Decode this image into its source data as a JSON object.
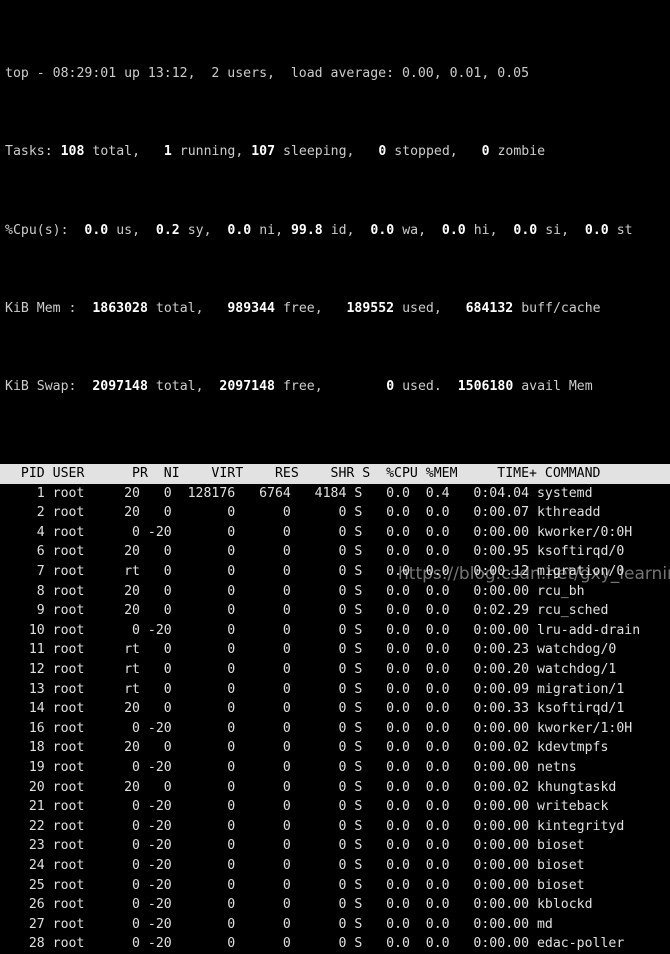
{
  "terminal": {
    "background_color": "#000000",
    "foreground_color": "#d8d8d8",
    "header_bar_bg": "#e2e2e2",
    "header_bar_fg": "#000000"
  },
  "summary": {
    "uptime_line": {
      "program": "top",
      "separator": "-",
      "time": "08:29:01",
      "up_label": "up",
      "uptime": "13:12,",
      "users_count": "2",
      "users_label": "users,",
      "load_label": "load average:",
      "load_1min": "0.00,",
      "load_5min": "0.01,",
      "load_15min": "0.05",
      "full": "top - 08:29:01 up 13:12,  2 users,  load average: 0.00, 0.01, 0.05"
    },
    "tasks_line": {
      "label": "Tasks:",
      "total": "108",
      "total_label": "total,",
      "running": "1",
      "running_label": "running,",
      "sleeping": "107",
      "sleeping_label": "sleeping,",
      "stopped": "0",
      "stopped_label": "stopped,",
      "zombie": "0",
      "zombie_label": "zombie"
    },
    "cpu_line": {
      "label": "%Cpu(s):",
      "us": "0.0",
      "us_label": "us,",
      "sy": "0.2",
      "sy_label": "sy,",
      "ni": "0.0",
      "ni_label": "ni,",
      "id": "99.8",
      "id_label": "id,",
      "wa": "0.0",
      "wa_label": "wa,",
      "hi": "0.0",
      "hi_label": "hi,",
      "si": "0.0",
      "si_label": "si,",
      "st": "0.0",
      "st_label": "st"
    },
    "mem_line": {
      "label": "KiB Mem :",
      "total": "1863028",
      "total_label": "total,",
      "free": "989344",
      "free_label": "free,",
      "used": "189552",
      "used_label": "used,",
      "buff_cache": "684132",
      "buff_cache_label": "buff/cache"
    },
    "swap_line": {
      "label": "KiB Swap:",
      "total": "2097148",
      "total_label": "total,",
      "free": "2097148",
      "free_label": "free,",
      "used": "0",
      "used_label": "used.",
      "avail": "1506180",
      "avail_label": "avail Mem"
    }
  },
  "table": {
    "columns": [
      "PID",
      "USER",
      "PR",
      "NI",
      "VIRT",
      "RES",
      "SHR",
      "S",
      "%CPU",
      "%MEM",
      "TIME+",
      "COMMAND"
    ],
    "header_row": "  PID USER      PR  NI    VIRT    RES    SHR S  %CPU %MEM     TIME+ COMMAND",
    "rows": [
      {
        "pid": "1",
        "user": "root",
        "pr": "20",
        "ni": "0",
        "virt": "128176",
        "res": "6764",
        "shr": "4184",
        "s": "S",
        "cpu": "0.0",
        "mem": "0.4",
        "time": "0:04.04",
        "command": "systemd"
      },
      {
        "pid": "2",
        "user": "root",
        "pr": "20",
        "ni": "0",
        "virt": "0",
        "res": "0",
        "shr": "0",
        "s": "S",
        "cpu": "0.0",
        "mem": "0.0",
        "time": "0:00.07",
        "command": "kthreadd"
      },
      {
        "pid": "4",
        "user": "root",
        "pr": "0",
        "ni": "-20",
        "virt": "0",
        "res": "0",
        "shr": "0",
        "s": "S",
        "cpu": "0.0",
        "mem": "0.0",
        "time": "0:00.00",
        "command": "kworker/0:0H"
      },
      {
        "pid": "6",
        "user": "root",
        "pr": "20",
        "ni": "0",
        "virt": "0",
        "res": "0",
        "shr": "0",
        "s": "S",
        "cpu": "0.0",
        "mem": "0.0",
        "time": "0:00.95",
        "command": "ksoftirqd/0"
      },
      {
        "pid": "7",
        "user": "root",
        "pr": "rt",
        "ni": "0",
        "virt": "0",
        "res": "0",
        "shr": "0",
        "s": "S",
        "cpu": "0.0",
        "mem": "0.0",
        "time": "0:00.12",
        "command": "migration/0"
      },
      {
        "pid": "8",
        "user": "root",
        "pr": "20",
        "ni": "0",
        "virt": "0",
        "res": "0",
        "shr": "0",
        "s": "S",
        "cpu": "0.0",
        "mem": "0.0",
        "time": "0:00.00",
        "command": "rcu_bh"
      },
      {
        "pid": "9",
        "user": "root",
        "pr": "20",
        "ni": "0",
        "virt": "0",
        "res": "0",
        "shr": "0",
        "s": "S",
        "cpu": "0.0",
        "mem": "0.0",
        "time": "0:02.29",
        "command": "rcu_sched"
      },
      {
        "pid": "10",
        "user": "root",
        "pr": "0",
        "ni": "-20",
        "virt": "0",
        "res": "0",
        "shr": "0",
        "s": "S",
        "cpu": "0.0",
        "mem": "0.0",
        "time": "0:00.00",
        "command": "lru-add-drain"
      },
      {
        "pid": "11",
        "user": "root",
        "pr": "rt",
        "ni": "0",
        "virt": "0",
        "res": "0",
        "shr": "0",
        "s": "S",
        "cpu": "0.0",
        "mem": "0.0",
        "time": "0:00.23",
        "command": "watchdog/0"
      },
      {
        "pid": "12",
        "user": "root",
        "pr": "rt",
        "ni": "0",
        "virt": "0",
        "res": "0",
        "shr": "0",
        "s": "S",
        "cpu": "0.0",
        "mem": "0.0",
        "time": "0:00.20",
        "command": "watchdog/1"
      },
      {
        "pid": "13",
        "user": "root",
        "pr": "rt",
        "ni": "0",
        "virt": "0",
        "res": "0",
        "shr": "0",
        "s": "S",
        "cpu": "0.0",
        "mem": "0.0",
        "time": "0:00.09",
        "command": "migration/1"
      },
      {
        "pid": "14",
        "user": "root",
        "pr": "20",
        "ni": "0",
        "virt": "0",
        "res": "0",
        "shr": "0",
        "s": "S",
        "cpu": "0.0",
        "mem": "0.0",
        "time": "0:00.33",
        "command": "ksoftirqd/1"
      },
      {
        "pid": "16",
        "user": "root",
        "pr": "0",
        "ni": "-20",
        "virt": "0",
        "res": "0",
        "shr": "0",
        "s": "S",
        "cpu": "0.0",
        "mem": "0.0",
        "time": "0:00.00",
        "command": "kworker/1:0H"
      },
      {
        "pid": "18",
        "user": "root",
        "pr": "20",
        "ni": "0",
        "virt": "0",
        "res": "0",
        "shr": "0",
        "s": "S",
        "cpu": "0.0",
        "mem": "0.0",
        "time": "0:00.02",
        "command": "kdevtmpfs"
      },
      {
        "pid": "19",
        "user": "root",
        "pr": "0",
        "ni": "-20",
        "virt": "0",
        "res": "0",
        "shr": "0",
        "s": "S",
        "cpu": "0.0",
        "mem": "0.0",
        "time": "0:00.00",
        "command": "netns"
      },
      {
        "pid": "20",
        "user": "root",
        "pr": "20",
        "ni": "0",
        "virt": "0",
        "res": "0",
        "shr": "0",
        "s": "S",
        "cpu": "0.0",
        "mem": "0.0",
        "time": "0:00.02",
        "command": "khungtaskd"
      },
      {
        "pid": "21",
        "user": "root",
        "pr": "0",
        "ni": "-20",
        "virt": "0",
        "res": "0",
        "shr": "0",
        "s": "S",
        "cpu": "0.0",
        "mem": "0.0",
        "time": "0:00.00",
        "command": "writeback"
      },
      {
        "pid": "22",
        "user": "root",
        "pr": "0",
        "ni": "-20",
        "virt": "0",
        "res": "0",
        "shr": "0",
        "s": "S",
        "cpu": "0.0",
        "mem": "0.0",
        "time": "0:00.00",
        "command": "kintegrityd"
      },
      {
        "pid": "23",
        "user": "root",
        "pr": "0",
        "ni": "-20",
        "virt": "0",
        "res": "0",
        "shr": "0",
        "s": "S",
        "cpu": "0.0",
        "mem": "0.0",
        "time": "0:00.00",
        "command": "bioset"
      },
      {
        "pid": "24",
        "user": "root",
        "pr": "0",
        "ni": "-20",
        "virt": "0",
        "res": "0",
        "shr": "0",
        "s": "S",
        "cpu": "0.0",
        "mem": "0.0",
        "time": "0:00.00",
        "command": "bioset"
      },
      {
        "pid": "25",
        "user": "root",
        "pr": "0",
        "ni": "-20",
        "virt": "0",
        "res": "0",
        "shr": "0",
        "s": "S",
        "cpu": "0.0",
        "mem": "0.0",
        "time": "0:00.00",
        "command": "bioset"
      },
      {
        "pid": "26",
        "user": "root",
        "pr": "0",
        "ni": "-20",
        "virt": "0",
        "res": "0",
        "shr": "0",
        "s": "S",
        "cpu": "0.0",
        "mem": "0.0",
        "time": "0:00.00",
        "command": "kblockd"
      },
      {
        "pid": "27",
        "user": "root",
        "pr": "0",
        "ni": "-20",
        "virt": "0",
        "res": "0",
        "shr": "0",
        "s": "S",
        "cpu": "0.0",
        "mem": "0.0",
        "time": "0:00.00",
        "command": "md"
      },
      {
        "pid": "28",
        "user": "root",
        "pr": "0",
        "ni": "-20",
        "virt": "0",
        "res": "0",
        "shr": "0",
        "s": "S",
        "cpu": "0.0",
        "mem": "0.0",
        "time": "0:00.00",
        "command": "edac-poller"
      }
    ]
  },
  "watermark": {
    "text": "https://blog.csdn.net/gxy_learning"
  }
}
